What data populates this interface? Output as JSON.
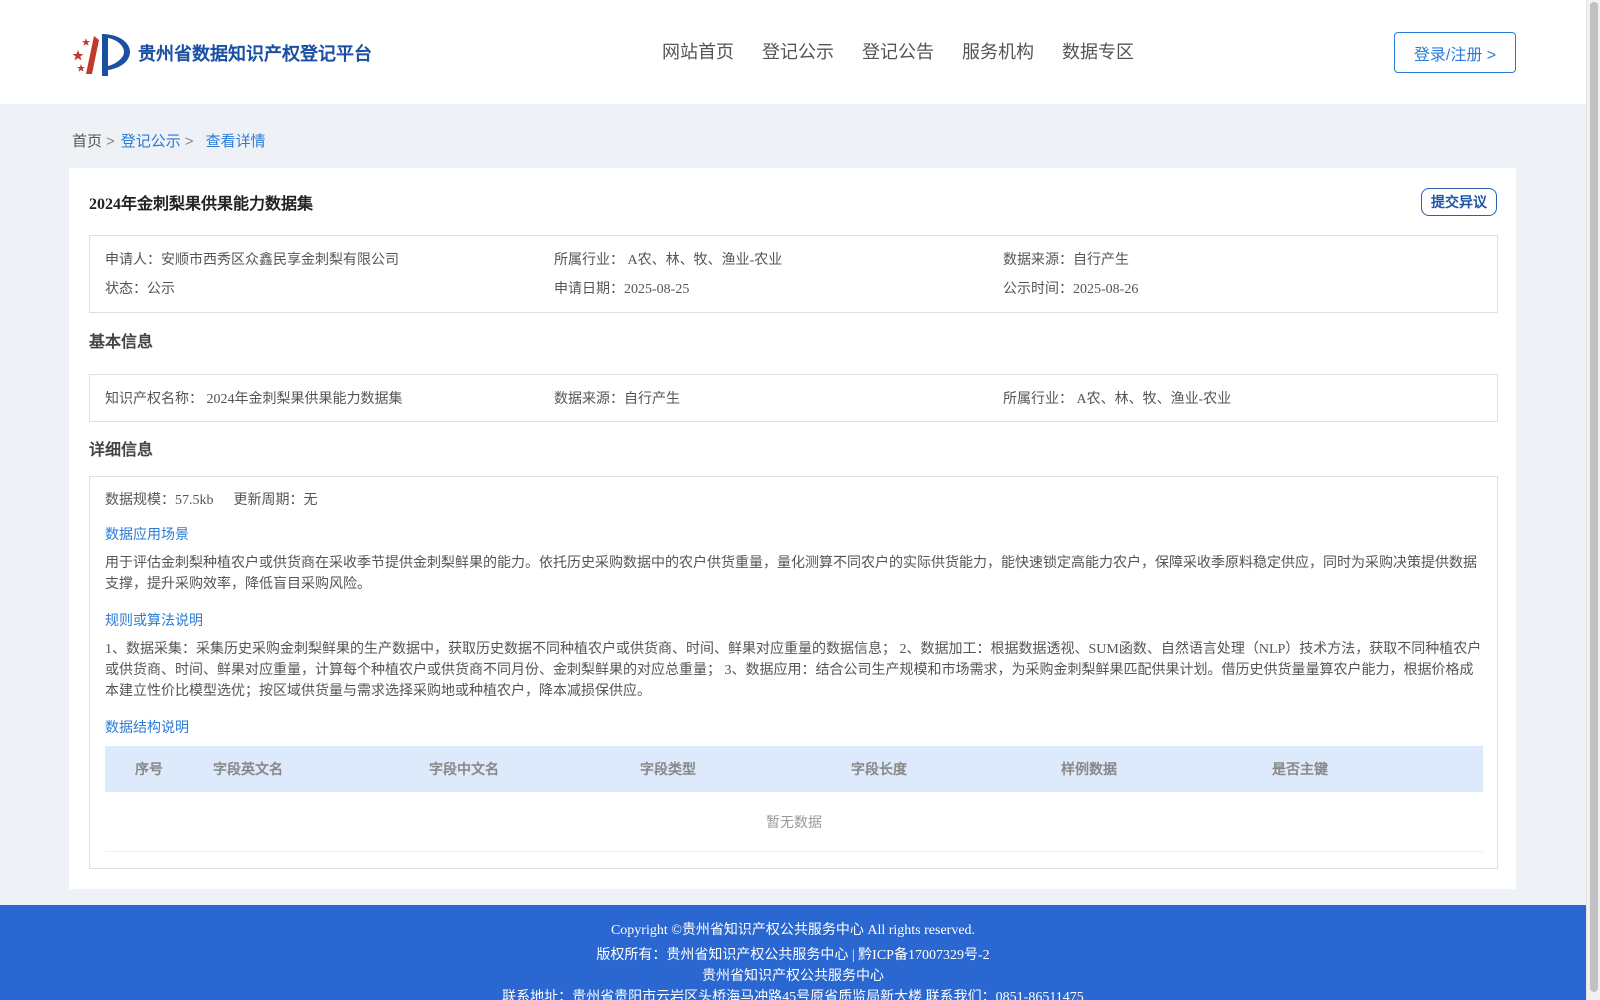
{
  "header": {
    "site_title": "贵州省数据知识产权登记平台",
    "nav": [
      "网站首页",
      "登记公示",
      "登记公告",
      "服务机构",
      "数据专区"
    ],
    "login_label": "登录/注册 >"
  },
  "breadcrumb": {
    "home": "首页",
    "section": "登记公示",
    "current": "查看详情",
    "sep": ">"
  },
  "record": {
    "title": "2024年金刺梨果供果能力数据集",
    "dispute_label": "提交异议",
    "summary": {
      "applicant_label": "申请人：",
      "applicant": "安顺市西秀区众鑫民享金刺梨有限公司",
      "industry_label": "所属行业：",
      "industry": "A农、林、牧、渔业-农业",
      "source_label": "数据来源：",
      "source": "自行产生",
      "status_label": "状态：",
      "status": "公示",
      "apply_date_label": "申请日期：",
      "apply_date": "2025-08-25",
      "publish_date_label": "公示时间：",
      "publish_date": "2025-08-26"
    }
  },
  "basic": {
    "section_title": "基本信息",
    "ip_name_label": "知识产权名称：",
    "ip_name": "2024年金刺梨果供果能力数据集",
    "source_label": "数据来源：",
    "source": "自行产生",
    "industry_label": "所属行业：",
    "industry": "A农、林、牧、渔业-农业"
  },
  "detail": {
    "section_title": "详细信息",
    "scale_label": "数据规模：",
    "scale": "57.5kb",
    "cycle_label": "更新周期：",
    "cycle": "无",
    "scenario_title": "数据应用场景",
    "scenario_text": "用于评估金刺梨种植农户或供货商在采收季节提供金刺梨鲜果的能力。依托历史采购数据中的农户供货重量，量化测算不同农户的实际供货能力，能快速锁定高能力农户，保障采收季原料稳定供应，同时为采购决策提供数据支撑，提升采购效率，降低盲目采购风险。",
    "algorithm_title": "规则或算法说明",
    "algorithm_text": "1、数据采集：采集历史采购金刺梨鲜果的生产数据中，获取历史数据不同种植农户或供货商、时间、鲜果对应重量的数据信息； 2、数据加工：根据数据透视、SUM函数、自然语言处理（NLP）技术方法，获取不同种植农户或供货商、时间、鲜果对应重量，计算每个种植农户或供货商不同月份、金刺梨鲜果的对应总重量； 3、数据应用：结合公司生产规模和市场需求，为采购金刺梨鲜果匹配供果计划。借历史供货量量算农户能力，根据价格成本建立性价比模型选优；按区域供货量与需求选择采购地或种植农户，降本减损保供应。",
    "structure_title": "数据结构说明",
    "table_headers": [
      "序号",
      "字段英文名",
      "字段中文名",
      "字段类型",
      "字段长度",
      "样例数据",
      "是否主键"
    ],
    "empty_text": "暂无数据"
  },
  "footer": {
    "copyright": "Copyright ©贵州省知识产权公共服务中心 All rights reserved.",
    "owner": "版权所有：贵州省知识产权公共服务中心 | 黔ICP备17007329号-2",
    "org": "贵州省知识产权公共服务中心",
    "contact": "联系地址：贵州省贵阳市云岩区头桥海马冲路45号原省质监局新大楼 联系我们：0851-86511475"
  }
}
